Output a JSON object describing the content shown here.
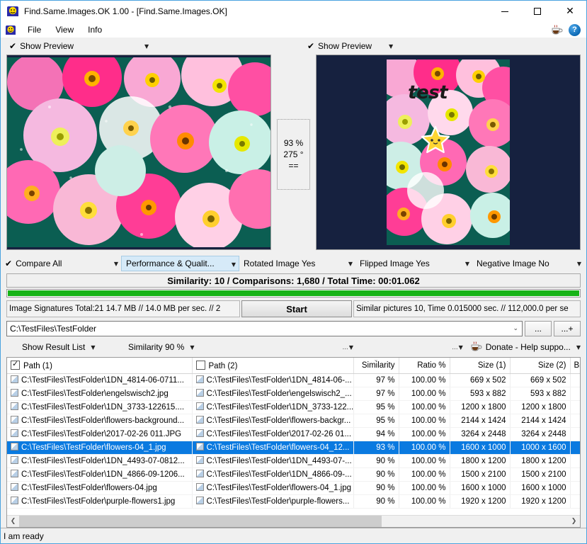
{
  "window": {
    "title": "Find.Same.Images.OK 1.00 - [Find.Same.Images.OK]",
    "app_icon": "app-icon",
    "minimize": "—",
    "maximize": "▢",
    "close": "✕"
  },
  "menu": {
    "icon": "app-icon",
    "items": [
      "File",
      "View",
      "Info"
    ],
    "right_icons": [
      "coffee-icon",
      "help-icon"
    ],
    "help_glyph": "?"
  },
  "preview_bars": {
    "left": {
      "check": "✔",
      "label": "Show Preview",
      "caret": "▼"
    },
    "right": {
      "check": "✔",
      "label": "Show Preview",
      "caret": "▼"
    }
  },
  "middle_info": {
    "similarity": "93 %",
    "rotation": "275 °",
    "equal": "=="
  },
  "previews": {
    "left_alt": "flowers landscape preview",
    "right_alt": "flowers portrait preview",
    "right_overlay_text": "test",
    "background_color": "#16213f"
  },
  "options": [
    {
      "check": "✔",
      "label": "Compare All",
      "caret": "▼",
      "selected": false
    },
    {
      "check": "",
      "label": "Performance & Qualit...",
      "caret": "▼",
      "selected": true
    },
    {
      "check": "",
      "label": "Rotated Image Yes",
      "caret": "▼",
      "selected": false
    },
    {
      "check": "",
      "label": "Flipped Image Yes",
      "caret": "▼",
      "selected": false
    },
    {
      "check": "",
      "label": "Negative Image No",
      "caret": "▼",
      "selected": false
    }
  ],
  "similarity_bar": {
    "text": "Similarity: 10 / Comparisons: 1,680 / Total Time: 00:01.062"
  },
  "progress": {
    "percent": 100,
    "color": "#16b316"
  },
  "stats": {
    "left": "Image Signatures Total:21  14.7 MB // 14.0 MB per sec. // 2",
    "start_button": "Start",
    "right": "Similar pictures 10, Time 0.015000 sec. // 112,000.0 per se"
  },
  "path": {
    "value": "C:\\TestFiles\\TestFolder",
    "dropdown": "⌄",
    "browse": "...",
    "add": "...+"
  },
  "result_toolbar": {
    "show_result_list": "Show Result List",
    "similarity": "Similarity 90 %",
    "extra1": "...",
    "extra2": "...",
    "donate": "Donate - Help suppo...",
    "caret": "▼"
  },
  "table": {
    "headers": [
      {
        "label": "Path (1)",
        "checkbox": true,
        "checked": true,
        "align": "left"
      },
      {
        "label": "Path (2)",
        "checkbox": true,
        "checked": false,
        "align": "left"
      },
      {
        "label": "Similarity",
        "sorted": true,
        "align": "right"
      },
      {
        "label": "Ratio %",
        "align": "right"
      },
      {
        "label": "Size (1)",
        "align": "right"
      },
      {
        "label": "Size (2)",
        "align": "right"
      },
      {
        "label": "Brigh",
        "align": "right"
      }
    ],
    "rows": [
      {
        "path1": "C:\\TestFiles\\TestFolder\\1DN_4814-06-0711...",
        "path2": "C:\\TestFiles\\TestFolder\\1DN_4814-06-...",
        "similarity": "97 %",
        "ratio": "100.00 %",
        "size1": "669 x 502",
        "size2": "669 x 502",
        "bright": "",
        "selected": false
      },
      {
        "path1": "C:\\TestFiles\\TestFolder\\engelswisch2.jpg",
        "path2": "C:\\TestFiles\\TestFolder\\engelswisch2_...",
        "similarity": "97 %",
        "ratio": "100.00 %",
        "size1": "593 x 882",
        "size2": "593 x 882",
        "bright": "",
        "selected": false
      },
      {
        "path1": "C:\\TestFiles\\TestFolder\\1DN_3733-122615....",
        "path2": "C:\\TestFiles\\TestFolder\\1DN_3733-122...",
        "similarity": "95 %",
        "ratio": "100.00 %",
        "size1": "1200 x 1800",
        "size2": "1200 x 1800",
        "bright": "",
        "selected": false
      },
      {
        "path1": "C:\\TestFiles\\TestFolder\\flowers-background...",
        "path2": "C:\\TestFiles\\TestFolder\\flowers-backgr...",
        "similarity": "95 %",
        "ratio": "100.00 %",
        "size1": "2144 x 1424",
        "size2": "2144 x 1424",
        "bright": "",
        "selected": false
      },
      {
        "path1": "C:\\TestFiles\\TestFolder\\2017-02-26 011.JPG",
        "path2": "C:\\TestFiles\\TestFolder\\2017-02-26 01...",
        "similarity": "94 %",
        "ratio": "100.00 %",
        "size1": "3264 x 2448",
        "size2": "3264 x 2448",
        "bright": "",
        "selected": false
      },
      {
        "path1": "C:\\TestFiles\\TestFolder\\flowers-04_1.jpg",
        "path2": "C:\\TestFiles\\TestFolder\\flowers-04_12...",
        "similarity": "93 %",
        "ratio": "100.00 %",
        "size1": "1600 x 1000",
        "size2": "1000 x 1600",
        "bright": "",
        "selected": true
      },
      {
        "path1": "C:\\TestFiles\\TestFolder\\1DN_4493-07-0812...",
        "path2": "C:\\TestFiles\\TestFolder\\1DN_4493-07-...",
        "similarity": "90 %",
        "ratio": "100.00 %",
        "size1": "1800 x 1200",
        "size2": "1800 x 1200",
        "bright": "",
        "selected": false
      },
      {
        "path1": "C:\\TestFiles\\TestFolder\\1DN_4866-09-1206...",
        "path2": "C:\\TestFiles\\TestFolder\\1DN_4866-09-...",
        "similarity": "90 %",
        "ratio": "100.00 %",
        "size1": "1500 x 2100",
        "size2": "1500 x 2100",
        "bright": "",
        "selected": false
      },
      {
        "path1": "C:\\TestFiles\\TestFolder\\flowers-04.jpg",
        "path2": "C:\\TestFiles\\TestFolder\\flowers-04_1.jpg",
        "similarity": "90 %",
        "ratio": "100.00 %",
        "size1": "1600 x 1000",
        "size2": "1600 x 1000",
        "bright": "",
        "selected": false
      },
      {
        "path1": "C:\\TestFiles\\TestFolder\\purple-flowers1.jpg",
        "path2": "C:\\TestFiles\\TestFolder\\purple-flowers...",
        "similarity": "90 %",
        "ratio": "100.00 %",
        "size1": "1920 x 1200",
        "size2": "1920 x 1200",
        "bright": "",
        "selected": false
      }
    ]
  },
  "hscroll": {
    "left_arrow": "❮",
    "right_arrow": "❯"
  },
  "statusbar": {
    "text": "I am ready"
  }
}
